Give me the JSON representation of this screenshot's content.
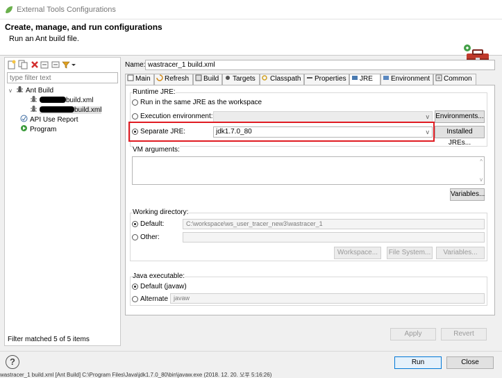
{
  "window": {
    "title": "External Tools Configurations"
  },
  "banner": {
    "heading": "Create, manage, and run configurations",
    "subtitle": "Run an Ant build file.",
    "icon": "toolbox-icon"
  },
  "left": {
    "toolbar_icons": [
      "new-config-icon",
      "duplicate-icon",
      "delete-icon",
      "collapse-all-icon",
      "filter-icon",
      "dropdown-arrow-icon"
    ],
    "filter_placeholder": "type filter text",
    "tree": [
      {
        "label": "Ant Build",
        "icon": "ant-icon",
        "expanded": true
      },
      {
        "label": "build.xml",
        "icon": "ant-file-icon",
        "redacted": true
      },
      {
        "label": "build.xml",
        "icon": "ant-file-icon",
        "redacted": true,
        "selected": true
      },
      {
        "label": "API Use Report",
        "icon": "api-report-icon"
      },
      {
        "label": "Program",
        "icon": "program-icon"
      }
    ],
    "filter_status": "Filter matched 5 of 5 items"
  },
  "right": {
    "name_label": "Name:",
    "name_value": "wastracer_1 build.xml",
    "tabs": [
      {
        "label": "Main",
        "icon": "main-tab-icon"
      },
      {
        "label": "Refresh",
        "icon": "refresh-icon"
      },
      {
        "label": "Build",
        "icon": "build-icon"
      },
      {
        "label": "Targets",
        "icon": "targets-icon"
      },
      {
        "label": "Classpath",
        "icon": "classpath-icon"
      },
      {
        "label": "Properties",
        "icon": "properties-icon"
      },
      {
        "label": "JRE",
        "icon": "jre-icon",
        "selected": true
      },
      {
        "label": "Environment",
        "icon": "environment-icon"
      },
      {
        "label": "Common",
        "icon": "common-icon"
      }
    ],
    "runtime_jre": {
      "group_label": "Runtime JRE:",
      "opt_workspace": "Run in the same JRE as the workspace",
      "opt_exec_env": "Execution environment:",
      "environments_button": "Environments...",
      "opt_separate": "Separate JRE:",
      "separate_value": "jdk1.7.0_80",
      "installed_jres_button": "Installed JREs..."
    },
    "vm_args": {
      "label": "VM arguments:",
      "value": "",
      "variables_button": "Variables..."
    },
    "working_dir": {
      "group_label": "Working directory:",
      "opt_default": "Default:",
      "default_value": "C:\\workspace\\ws_user_tracer_new3\\wastracer_1",
      "opt_other": "Other:",
      "other_value": "",
      "workspace_button": "Workspace...",
      "filesystem_button": "File System...",
      "variables_button": "Variables..."
    },
    "java_exec": {
      "group_label": "Java executable:",
      "opt_default": "Default (javaw)",
      "opt_alternate": "Alternate",
      "alternate_value": "javaw"
    },
    "apply_button": "Apply",
    "revert_button": "Revert"
  },
  "footer": {
    "help": "?",
    "run_button": "Run",
    "close_button": "Close"
  },
  "statusbar": {
    "text": "wastracer_1 build.xml [Ant Build] C:\\Program Files\\Java\\jdk1.7.0_80\\bin\\javaw.exe (2018. 12. 20. 오후 5:16:26)"
  },
  "colors": {
    "highlight": "#e01b22",
    "accent": "#0078d7"
  }
}
